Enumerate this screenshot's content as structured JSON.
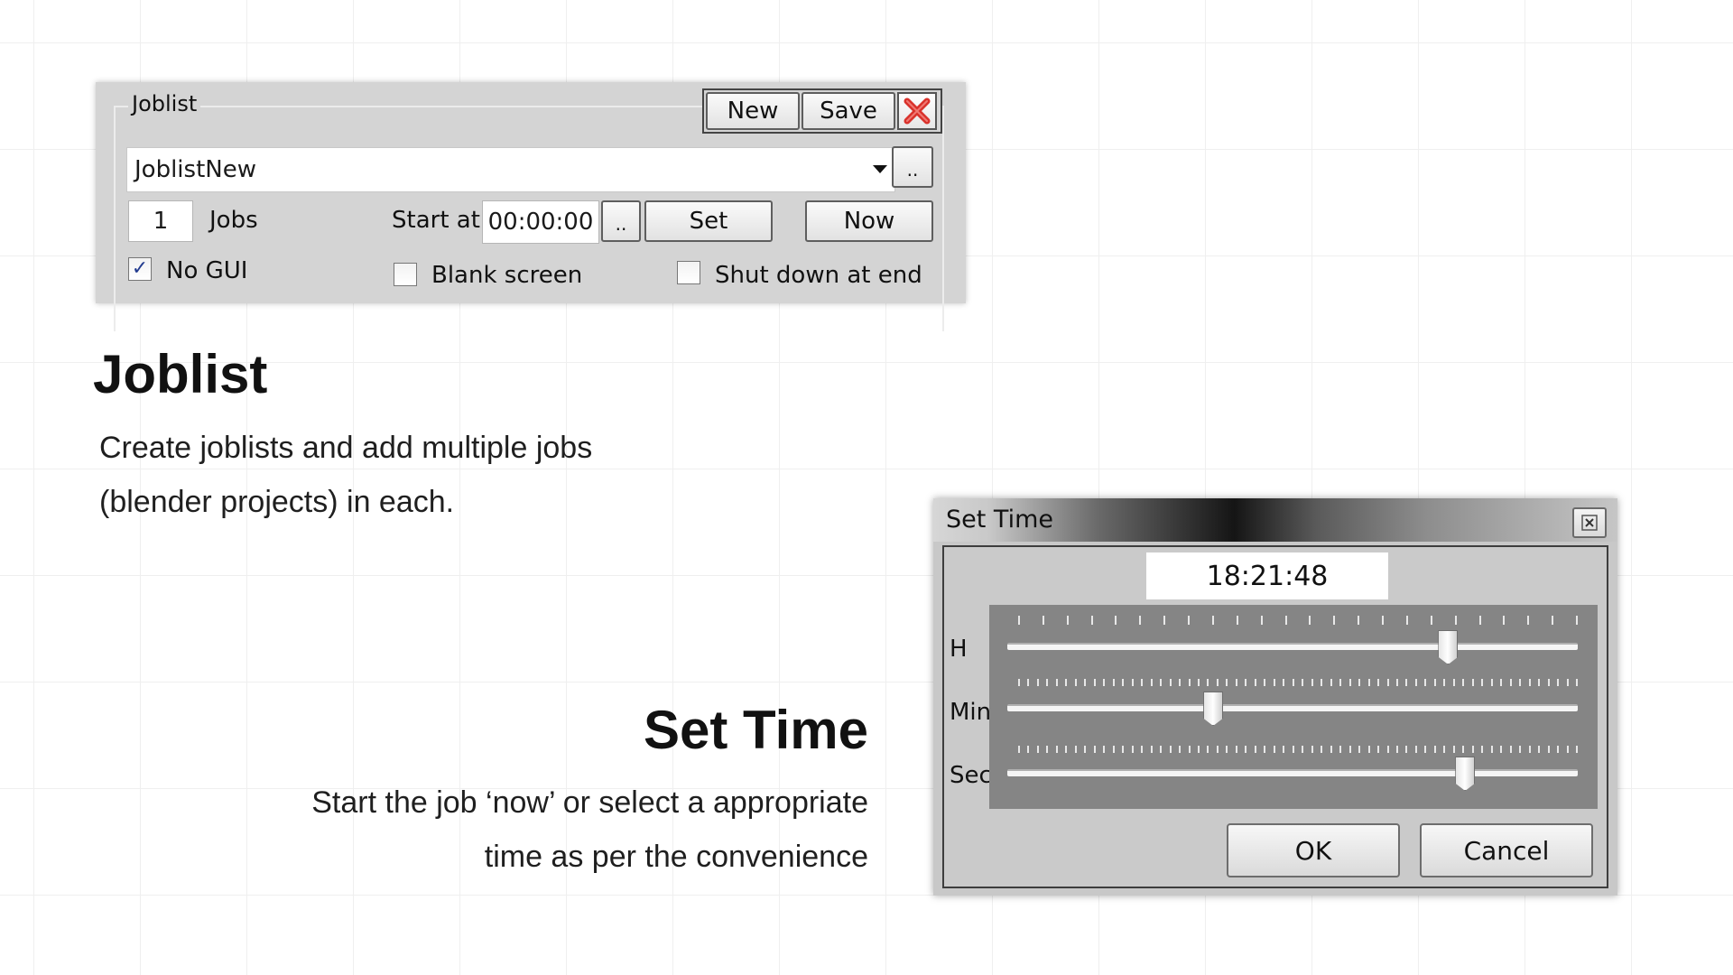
{
  "joblist_panel": {
    "legend": "Joblist",
    "new_button": "New",
    "save_button": "Save",
    "combo_value": "JoblistNew",
    "browse_button": "..",
    "jobs_count": "1",
    "jobs_label": "Jobs",
    "start_at_label": "Start at",
    "start_time": "00:00:00",
    "time_picker_button": "..",
    "set_button": "Set",
    "now_button": "Now",
    "no_gui": {
      "label": "No GUI",
      "checked": true
    },
    "blank_screen": {
      "label": "Blank screen",
      "checked": false
    },
    "shutdown": {
      "label": "Shut down at end",
      "checked": false
    },
    "close_icon": "close-red-x-icon",
    "check_mark": "✓"
  },
  "joblist_section": {
    "title": "Joblist",
    "description_line1": "Create joblists and add multiple jobs",
    "description_line2": "(blender projects) in each."
  },
  "settime_section": {
    "title": "Set Time",
    "description_line1": "Start the job ‘now’ or select a appropriate",
    "description_line2": "time as per the convenience"
  },
  "settime_dialog": {
    "title": "Set Time",
    "time_value": "18:21:48",
    "hour_label": "H",
    "minute_label": "Min",
    "second_label": "Sec",
    "hour_value": 18,
    "hour_max": 23,
    "minute_value": 21,
    "minute_max": 59,
    "second_value": 48,
    "second_max": 59,
    "ok_button": "OK",
    "cancel_button": "Cancel",
    "close_icon": "close-icon"
  },
  "colors": {
    "panel_bg": "#d4d4d4",
    "slider_bg": "#858585",
    "close_red": "#d9322c"
  }
}
